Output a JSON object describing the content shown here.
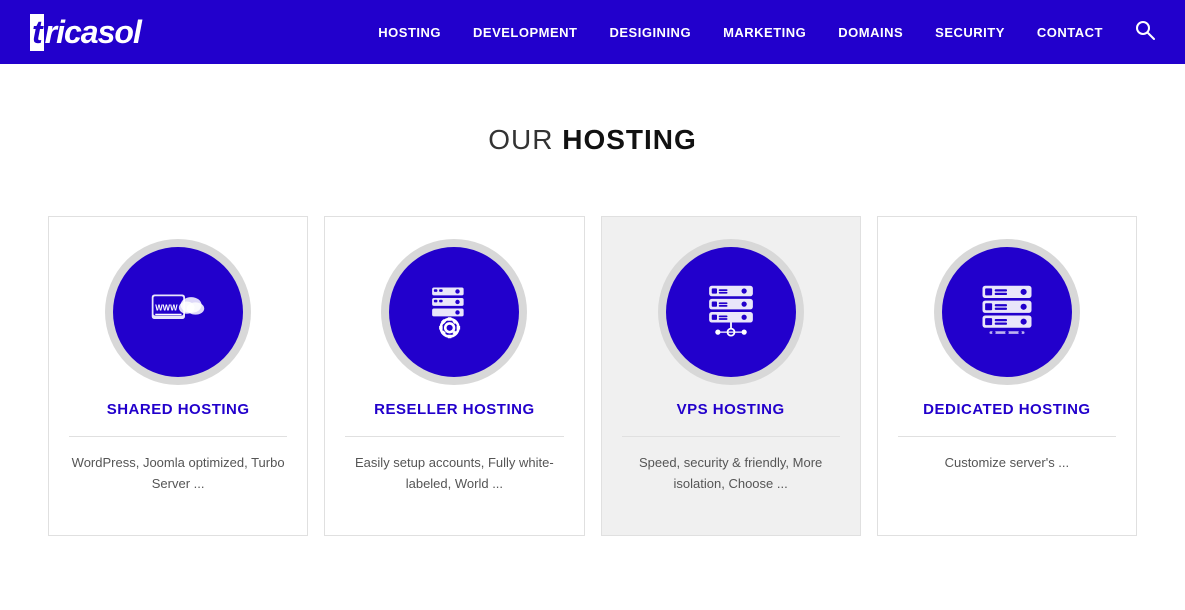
{
  "navbar": {
    "logo": "tricasol",
    "nav_items": [
      {
        "label": "HOSTING",
        "id": "hosting"
      },
      {
        "label": "DEVELOPMENT",
        "id": "development"
      },
      {
        "label": "DESIGINING",
        "id": "designing"
      },
      {
        "label": "MARKETING",
        "id": "marketing"
      },
      {
        "label": "DOMAINS",
        "id": "domains"
      },
      {
        "label": "SECURITY",
        "id": "security"
      },
      {
        "label": "CONTACT",
        "id": "contact"
      }
    ]
  },
  "page": {
    "section_title_prefix": "OUR ",
    "section_title_bold": "HOSTING"
  },
  "cards": [
    {
      "id": "shared-hosting",
      "title": "SHARED HOSTING",
      "description": "WordPress, Joomla optimized, Turbo Server ...",
      "highlighted": false
    },
    {
      "id": "reseller-hosting",
      "title": "RESELLER HOSTING",
      "description": "Easily setup accounts, Fully white-labeled, World ...",
      "highlighted": false
    },
    {
      "id": "vps-hosting",
      "title": "VPS HOSTING",
      "description": "Speed, security & friendly, More isolation, Choose ...",
      "highlighted": true
    },
    {
      "id": "dedicated-hosting",
      "title": "DEDICATED HOSTING",
      "description": "Customize server's ...",
      "highlighted": false
    }
  ]
}
